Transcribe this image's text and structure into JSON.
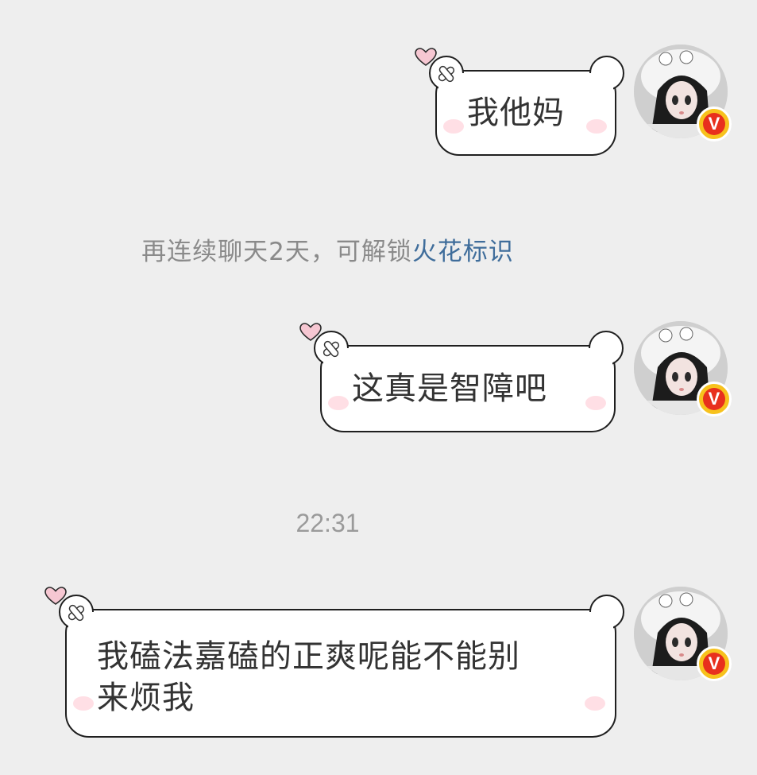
{
  "messages": [
    {
      "text": "我他妈"
    },
    {
      "text": "这真是智障吧"
    },
    {
      "text": "我磕法嘉磕的正爽呢能不能别来烦我"
    }
  ],
  "system_notice": {
    "prefix": "再连续聊天2天，可解锁",
    "link": "火花标识"
  },
  "timestamp": "22:31",
  "avatar": {
    "badge": "V"
  },
  "colors": {
    "background": "#eeeeee",
    "bubble": "#ffffff",
    "bubble_border": "#1f1f1f",
    "link": "#3f6d9b",
    "badge_outer": "#f7c21d",
    "badge_inner": "#e8301d",
    "heart": "#f6c7d2"
  }
}
